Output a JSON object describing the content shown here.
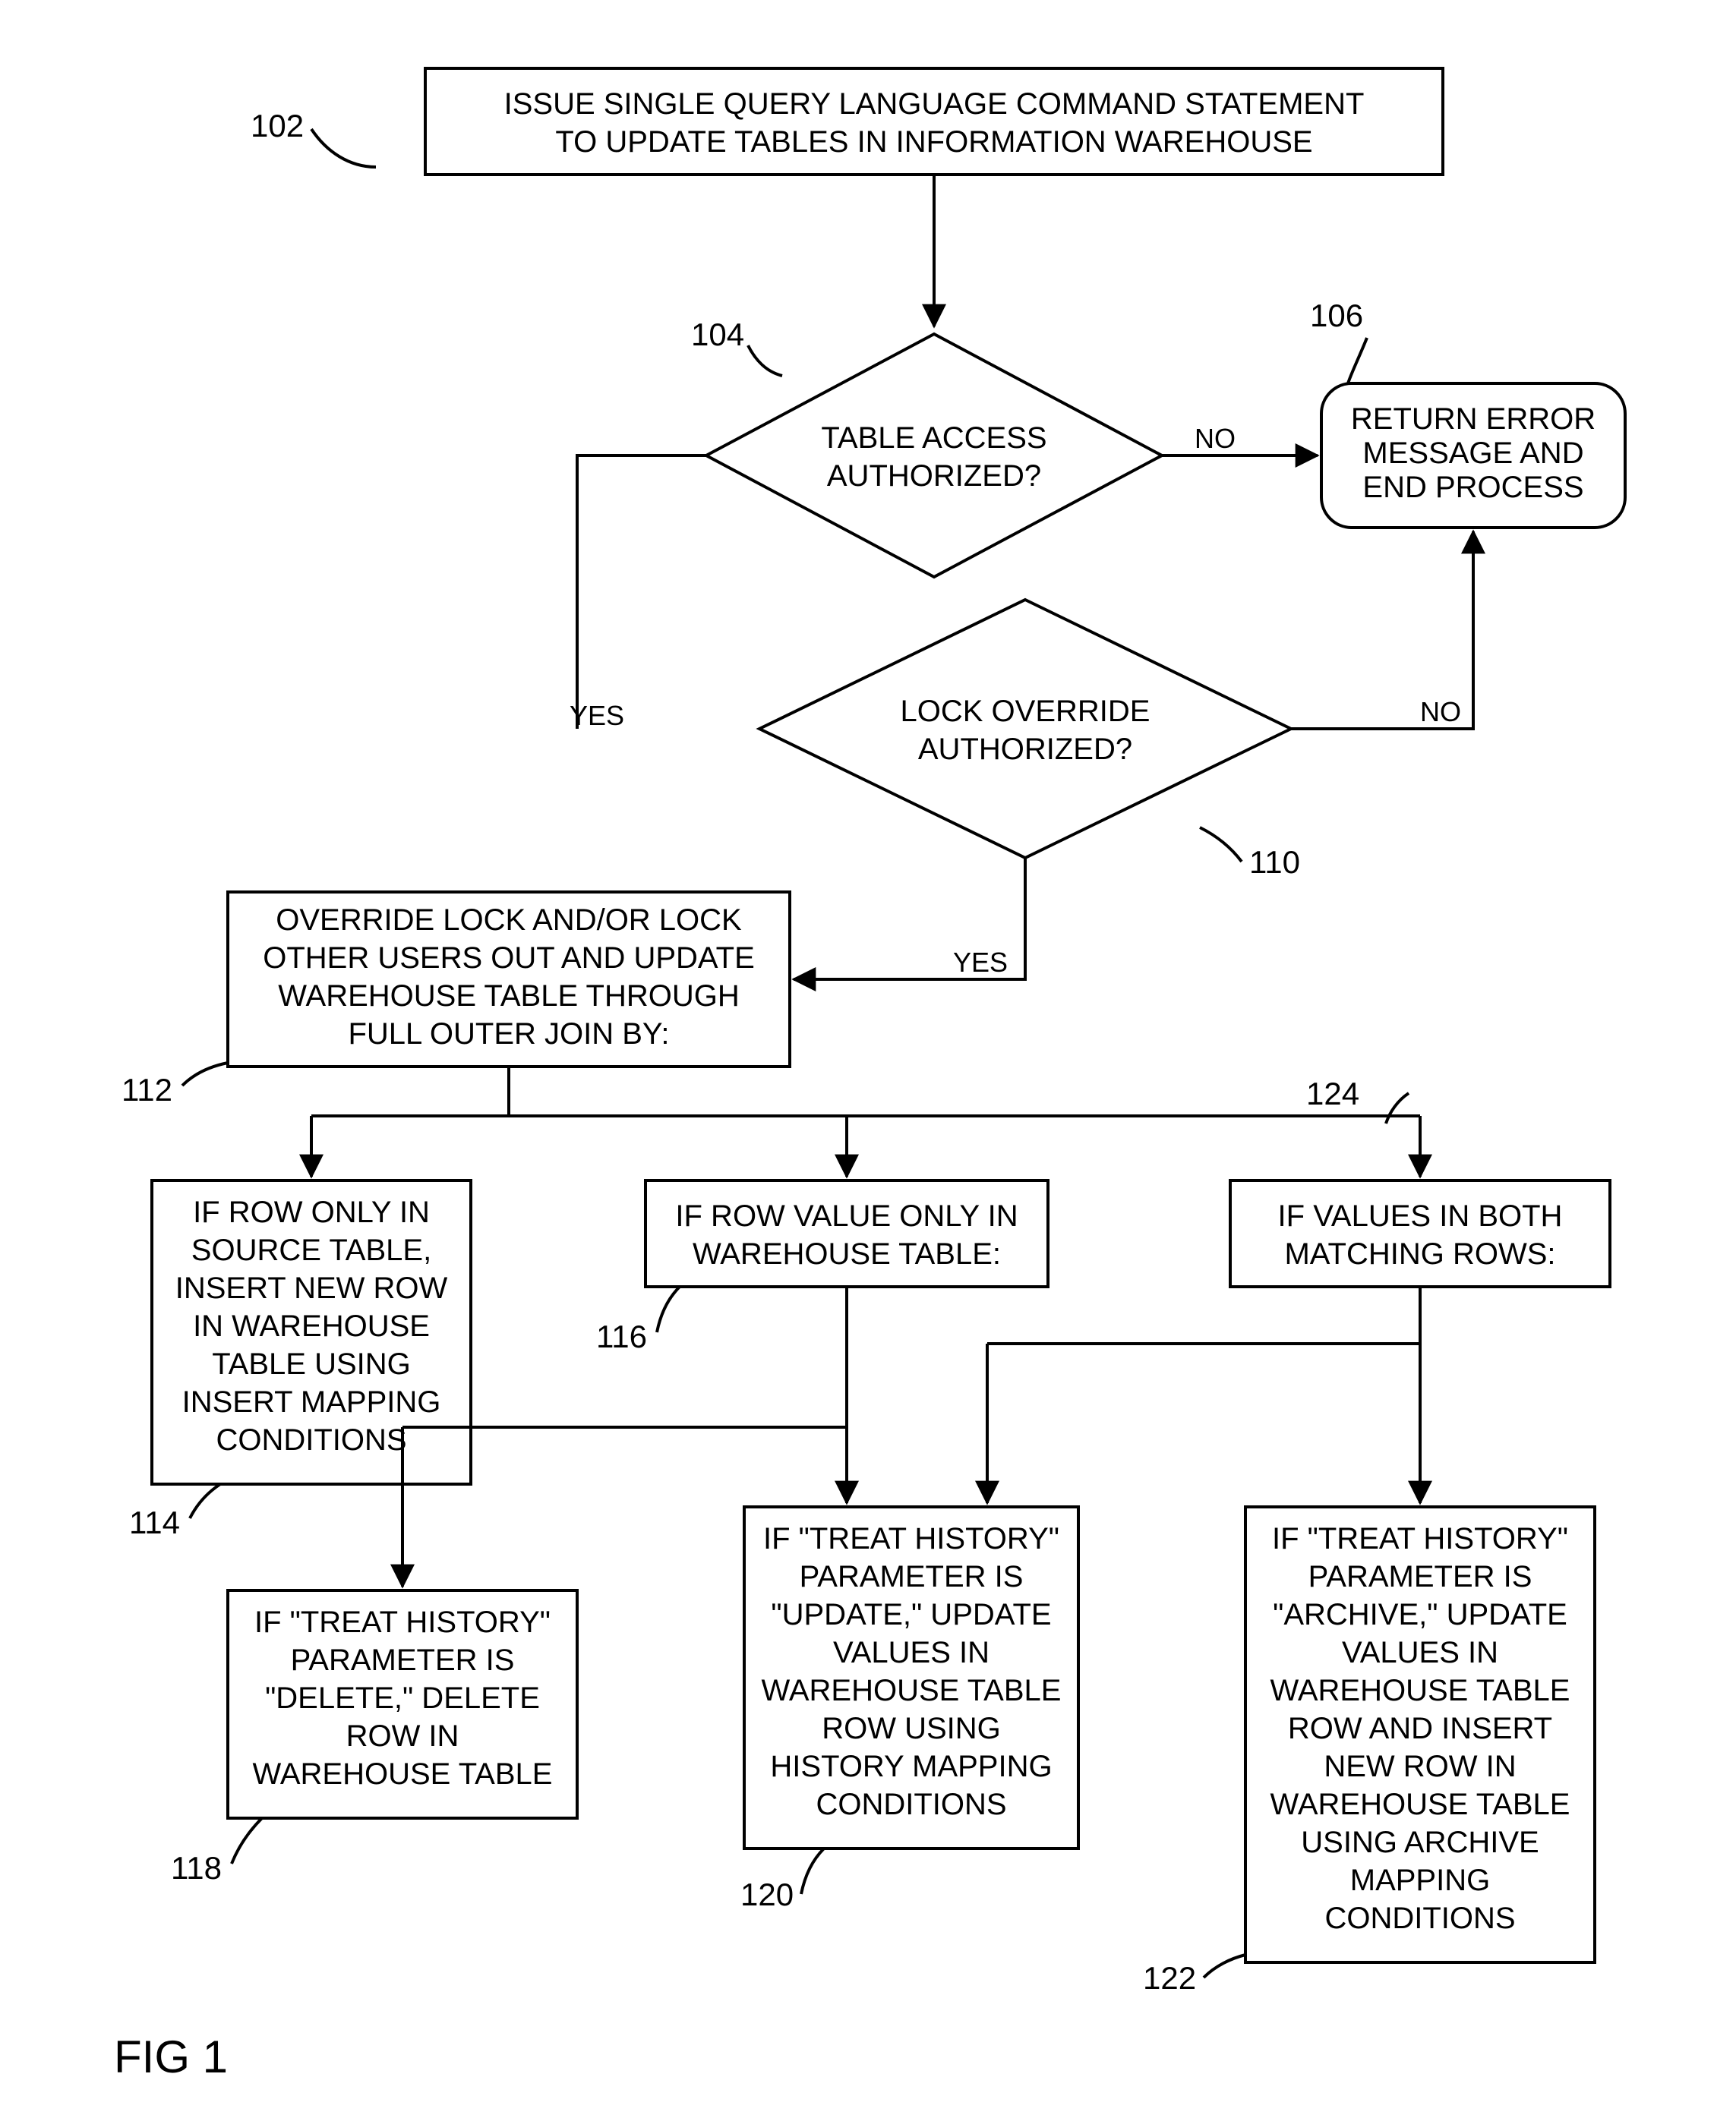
{
  "figure_label": "FIG 1",
  "nodes": {
    "n102": {
      "ref": "102",
      "lines": [
        "ISSUE SINGLE QUERY LANGUAGE COMMAND STATEMENT",
        "TO UPDATE TABLES IN INFORMATION WAREHOUSE"
      ]
    },
    "n104": {
      "ref": "104",
      "lines": [
        "TABLE ACCESS",
        "AUTHORIZED?"
      ]
    },
    "n106": {
      "ref": "106",
      "lines": [
        "RETURN ERROR",
        "MESSAGE AND",
        "END PROCESS"
      ]
    },
    "n110": {
      "ref": "110",
      "lines": [
        "LOCK OVERRIDE",
        "AUTHORIZED?"
      ]
    },
    "n112": {
      "ref": "112",
      "lines": [
        "OVERRIDE LOCK AND/OR LOCK",
        "OTHER USERS OUT AND UPDATE",
        "WAREHOUSE TABLE THROUGH",
        "FULL OUTER JOIN BY:"
      ]
    },
    "n114": {
      "ref": "114",
      "lines": [
        "IF ROW ONLY IN",
        "SOURCE TABLE,",
        "INSERT NEW ROW",
        "IN WAREHOUSE",
        "TABLE USING",
        "INSERT MAPPING",
        "CONDITIONS"
      ]
    },
    "n116": {
      "ref": "116",
      "lines": [
        "IF ROW VALUE ONLY IN",
        "WAREHOUSE TABLE:"
      ]
    },
    "n118": {
      "ref": "118",
      "lines": [
        "IF \"TREAT HISTORY\"",
        "PARAMETER IS",
        "\"DELETE,\" DELETE",
        "ROW IN",
        "WAREHOUSE TABLE"
      ]
    },
    "n120": {
      "ref": "120",
      "lines": [
        "IF \"TREAT HISTORY\"",
        "PARAMETER IS",
        "\"UPDATE,\" UPDATE",
        "VALUES IN",
        "WAREHOUSE TABLE",
        "ROW USING",
        "HISTORY MAPPING",
        "CONDITIONS"
      ]
    },
    "n122": {
      "ref": "122",
      "lines": [
        "IF \"TREAT HISTORY\"",
        "PARAMETER IS",
        "\"ARCHIVE,\" UPDATE",
        "VALUES IN",
        "WAREHOUSE TABLE",
        "ROW AND INSERT",
        "NEW ROW IN",
        "WAREHOUSE TABLE",
        "USING ARCHIVE",
        "MAPPING",
        "CONDITIONS"
      ]
    },
    "n124": {
      "ref": "124",
      "lines": [
        "IF VALUES IN BOTH",
        "MATCHING ROWS:"
      ]
    }
  },
  "edges": {
    "e104_106": "NO",
    "e104_110": "YES",
    "e110_106": "NO",
    "e110_112": "YES"
  }
}
